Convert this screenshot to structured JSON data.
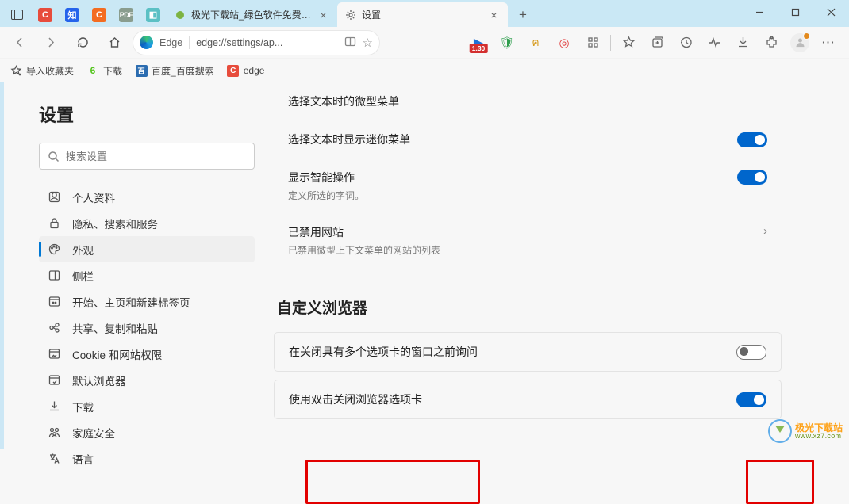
{
  "tabs": {
    "pinned": [
      {
        "name": "c-app",
        "cls": "p-red",
        "glyph": "C"
      },
      {
        "name": "zhihu",
        "cls": "p-blue",
        "glyph": "知"
      },
      {
        "name": "c-app2",
        "cls": "p-orange",
        "glyph": "C"
      },
      {
        "name": "pdf24",
        "cls": "p-grey",
        "glyph": "PDF"
      },
      {
        "name": "teal-app",
        "cls": "p-teal",
        "glyph": "◧"
      }
    ],
    "open": [
      {
        "label": "极光下载站_绿色软件免费下载_官",
        "active": false,
        "favicon_color": "#7cb342"
      },
      {
        "label": "设置",
        "active": true,
        "favicon": "gear"
      }
    ]
  },
  "toolbar": {
    "edge_label": "Edge",
    "url": "edge://settings/ap...",
    "badge": "1.30"
  },
  "bookmarks": [
    {
      "icon": "star",
      "label": "导入收藏夹"
    },
    {
      "icon": "green6",
      "label": "下载"
    },
    {
      "icon": "baidu",
      "label": "百度_百度搜索"
    },
    {
      "icon": "credC",
      "label": "edge"
    }
  ],
  "sidebar": {
    "title": "设置",
    "search_placeholder": "搜索设置",
    "items": [
      {
        "icon": "profile",
        "label": "个人资料"
      },
      {
        "icon": "lock",
        "label": "隐私、搜索和服务"
      },
      {
        "icon": "appearance",
        "label": "外观",
        "active": true
      },
      {
        "icon": "sidebar",
        "label": "侧栏"
      },
      {
        "icon": "home",
        "label": "开始、主页和新建标签页"
      },
      {
        "icon": "share",
        "label": "共享、复制和粘贴"
      },
      {
        "icon": "cookie",
        "label": "Cookie 和网站权限"
      },
      {
        "icon": "browser",
        "label": "默认浏览器"
      },
      {
        "icon": "download",
        "label": "下载"
      },
      {
        "icon": "family",
        "label": "家庭安全"
      },
      {
        "icon": "lang",
        "label": "语言"
      }
    ]
  },
  "settings": {
    "r1": "选择文本时的微型菜单",
    "r2": "选择文本时显示迷你菜单",
    "r3": "显示智能操作",
    "r3_sub": "定义所选的字词。",
    "r4": "已禁用网站",
    "r4_sub": "已禁用微型上下文菜单的网站的列表",
    "section2": "自定义浏览器",
    "r5": "在关闭具有多个选项卡的窗口之前询问",
    "r6": "使用双击关闭浏览器选项卡"
  },
  "watermark": {
    "cn": "极光下载站",
    "en": "www.xz7.com"
  }
}
